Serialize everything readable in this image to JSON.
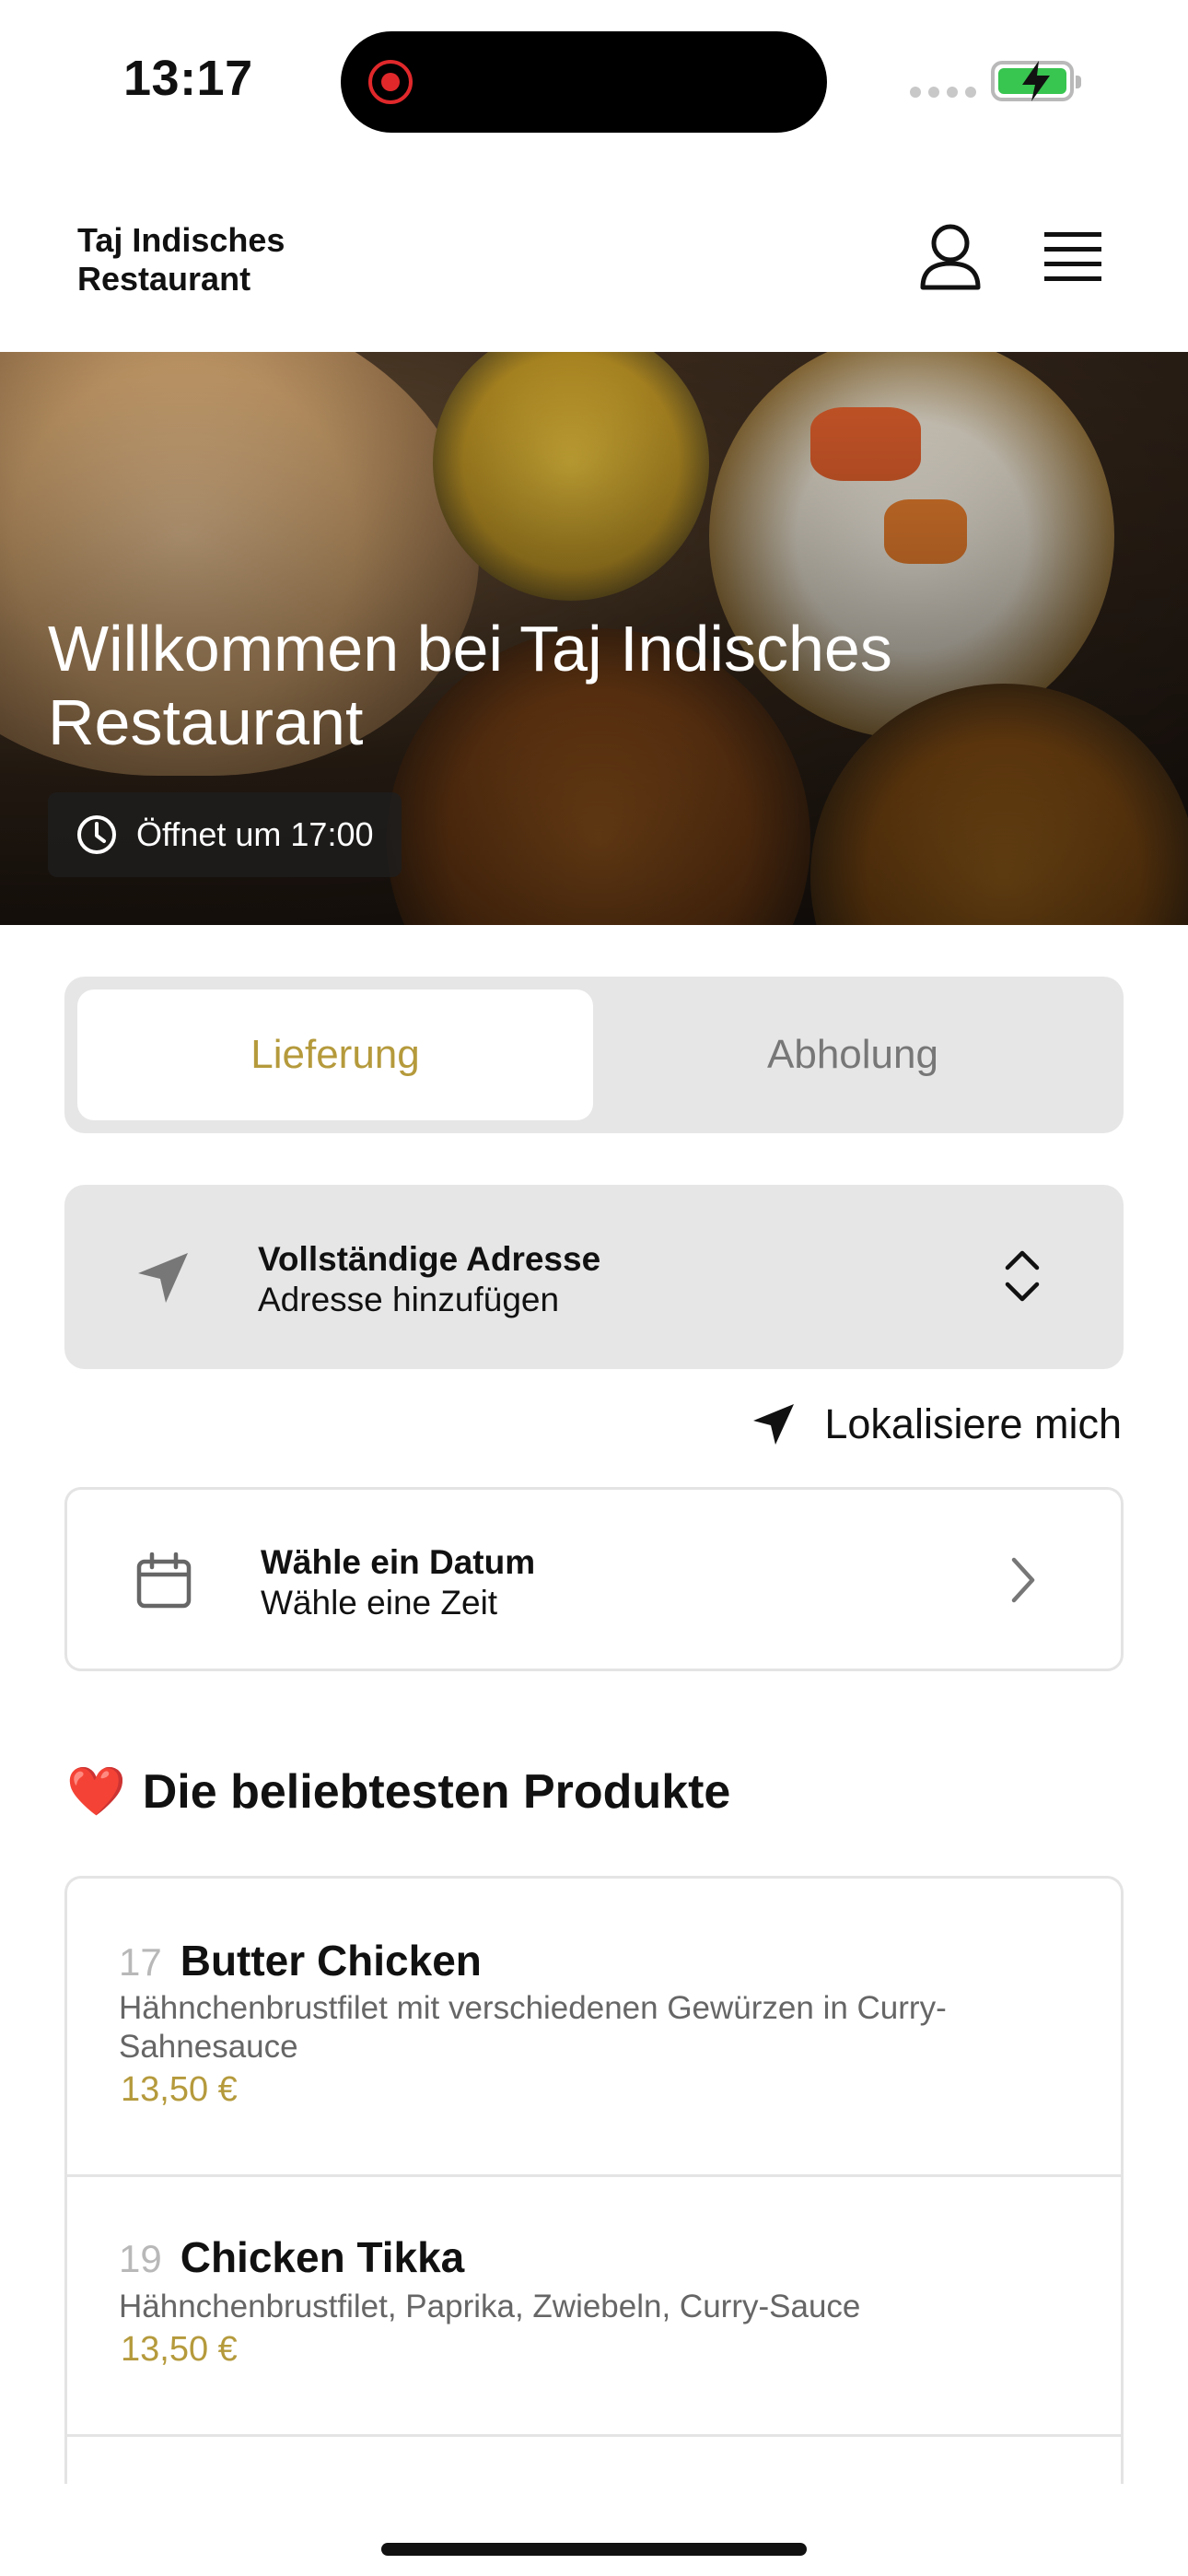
{
  "status_bar": {
    "time": "13:17"
  },
  "header": {
    "brand": "Taj Indisches Restaurant"
  },
  "hero": {
    "title": "Willkommen bei Taj Indisches Restaurant",
    "hours": "Öffnet um 17:00"
  },
  "order_mode": {
    "options": [
      "Lieferung",
      "Abholung"
    ],
    "selected": "Lieferung",
    "accent_color": "#b59a3c"
  },
  "address": {
    "title": "Vollständige Adresse",
    "subtitle": "Adresse hinzufügen"
  },
  "locate_me": "Lokalisiere mich",
  "schedule": {
    "title": "Wähle ein Datum",
    "subtitle": "Wähle eine Zeit"
  },
  "popular": {
    "emoji": "❤️",
    "title": "Die beliebtesten Produkte",
    "items": [
      {
        "number": "17",
        "name": "Butter Chicken",
        "description": "Hähnchenbrustfilet mit verschiedenen Gewürzen in Curry-Sahnesauce",
        "price": "13,50 €"
      },
      {
        "number": "19",
        "name": "Chicken Tikka",
        "description": "Hähnchenbrustfilet, Paprika, Zwiebeln, Curry-Sauce",
        "price": "13,50 €"
      }
    ]
  }
}
